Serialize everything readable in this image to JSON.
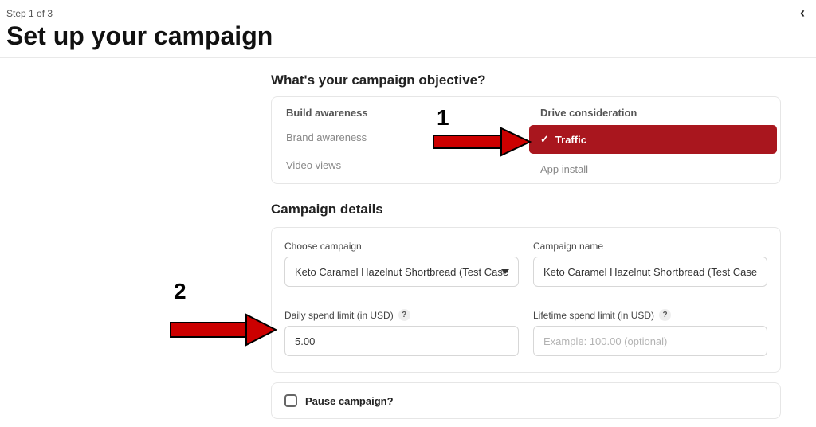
{
  "step": "Step 1 of 3",
  "title": "Set up your campaign",
  "objective": {
    "heading": "What's your campaign objective?",
    "left_header": "Build awareness",
    "left_items": [
      "Brand awareness",
      "Video views"
    ],
    "right_header": "Drive consideration",
    "right_items": [
      "Traffic",
      "App install"
    ],
    "selected": "Traffic"
  },
  "details": {
    "heading": "Campaign details",
    "choose_label": "Choose campaign",
    "choose_value": "Keto Caramel Hazelnut Shortbread (Test Case)",
    "name_label": "Campaign name",
    "name_value": "Keto Caramel Hazelnut Shortbread (Test Case)",
    "daily_label": "Daily spend limit (in USD)",
    "daily_value": "5.00",
    "lifetime_label": "Lifetime spend limit (in USD)",
    "lifetime_placeholder": "Example: 100.00 (optional)"
  },
  "pause_label": "Pause campaign?",
  "annotations": {
    "num1": "1",
    "num2": "2"
  }
}
